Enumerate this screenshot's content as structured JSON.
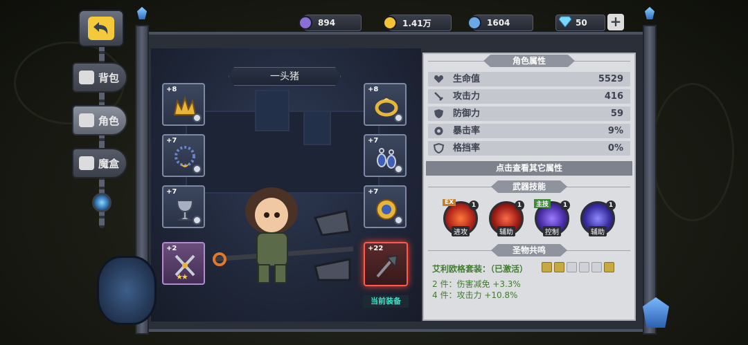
{
  "resources": [
    {
      "name": "purple-token-icon",
      "value": "894",
      "color": "#8a6fd8"
    },
    {
      "name": "gold-coin-icon",
      "value": "1.41万",
      "color": "#f4c434"
    },
    {
      "name": "blue-orb-icon",
      "value": "1604",
      "color": "#6aa8e8"
    },
    {
      "name": "diamond-icon",
      "value": "50",
      "color": "#7ad8ff"
    }
  ],
  "nav": {
    "back": "back-arrow-icon",
    "tabs": [
      {
        "label": "背包",
        "active": false
      },
      {
        "label": "角色",
        "active": true
      },
      {
        "label": "魔盒",
        "active": false
      }
    ]
  },
  "character": {
    "name": "一头猪"
  },
  "equipment": {
    "left": [
      {
        "level": "+8",
        "icon": "golden-crown-icon"
      },
      {
        "level": "+7",
        "icon": "bead-necklace-icon"
      },
      {
        "level": "+7",
        "icon": "silver-chalice-icon"
      },
      {
        "level": "+2",
        "icon": "crossed-swords-icon",
        "stars": "★★"
      }
    ],
    "right": [
      {
        "level": "+8",
        "icon": "moon-ring-icon"
      },
      {
        "level": "+7",
        "icon": "blue-earrings-icon"
      },
      {
        "level": "+7",
        "icon": "sun-amulet-icon"
      },
      {
        "level": "+22",
        "icon": "battle-axe-icon"
      }
    ],
    "current_label": "当前装备"
  },
  "attributes": {
    "title": "角色属性",
    "stats": [
      {
        "label": "生命值",
        "value": "5529",
        "icon": "heart-icon"
      },
      {
        "label": "攻击力",
        "value": "416",
        "icon": "sword-icon"
      },
      {
        "label": "防御力",
        "value": "59",
        "icon": "shield-icon"
      },
      {
        "label": "暴击率",
        "value": "9%",
        "icon": "crit-icon"
      },
      {
        "label": "格挡率",
        "value": "0%",
        "icon": "block-icon"
      }
    ],
    "more": "点击查看其它属性"
  },
  "skills": {
    "title": "武器技能",
    "items": [
      {
        "tag": "EX",
        "count": "1",
        "label": "进攻",
        "color": "#c8331f"
      },
      {
        "tag": "",
        "count": "1",
        "label": "辅助",
        "color": "#b5281c"
      },
      {
        "tag": "主技",
        "count": "1",
        "label": "控制",
        "color": "#5b3bb5"
      },
      {
        "tag": "",
        "count": "1",
        "label": "辅助",
        "color": "#4a3aa8"
      }
    ]
  },
  "resonance": {
    "title": "圣物共鸣",
    "set": "艾利欧格套装：（已激活）",
    "bonuses": [
      "2 件：伤害减免 +3.3%",
      "4 件：攻击力 +10.8%"
    ]
  }
}
